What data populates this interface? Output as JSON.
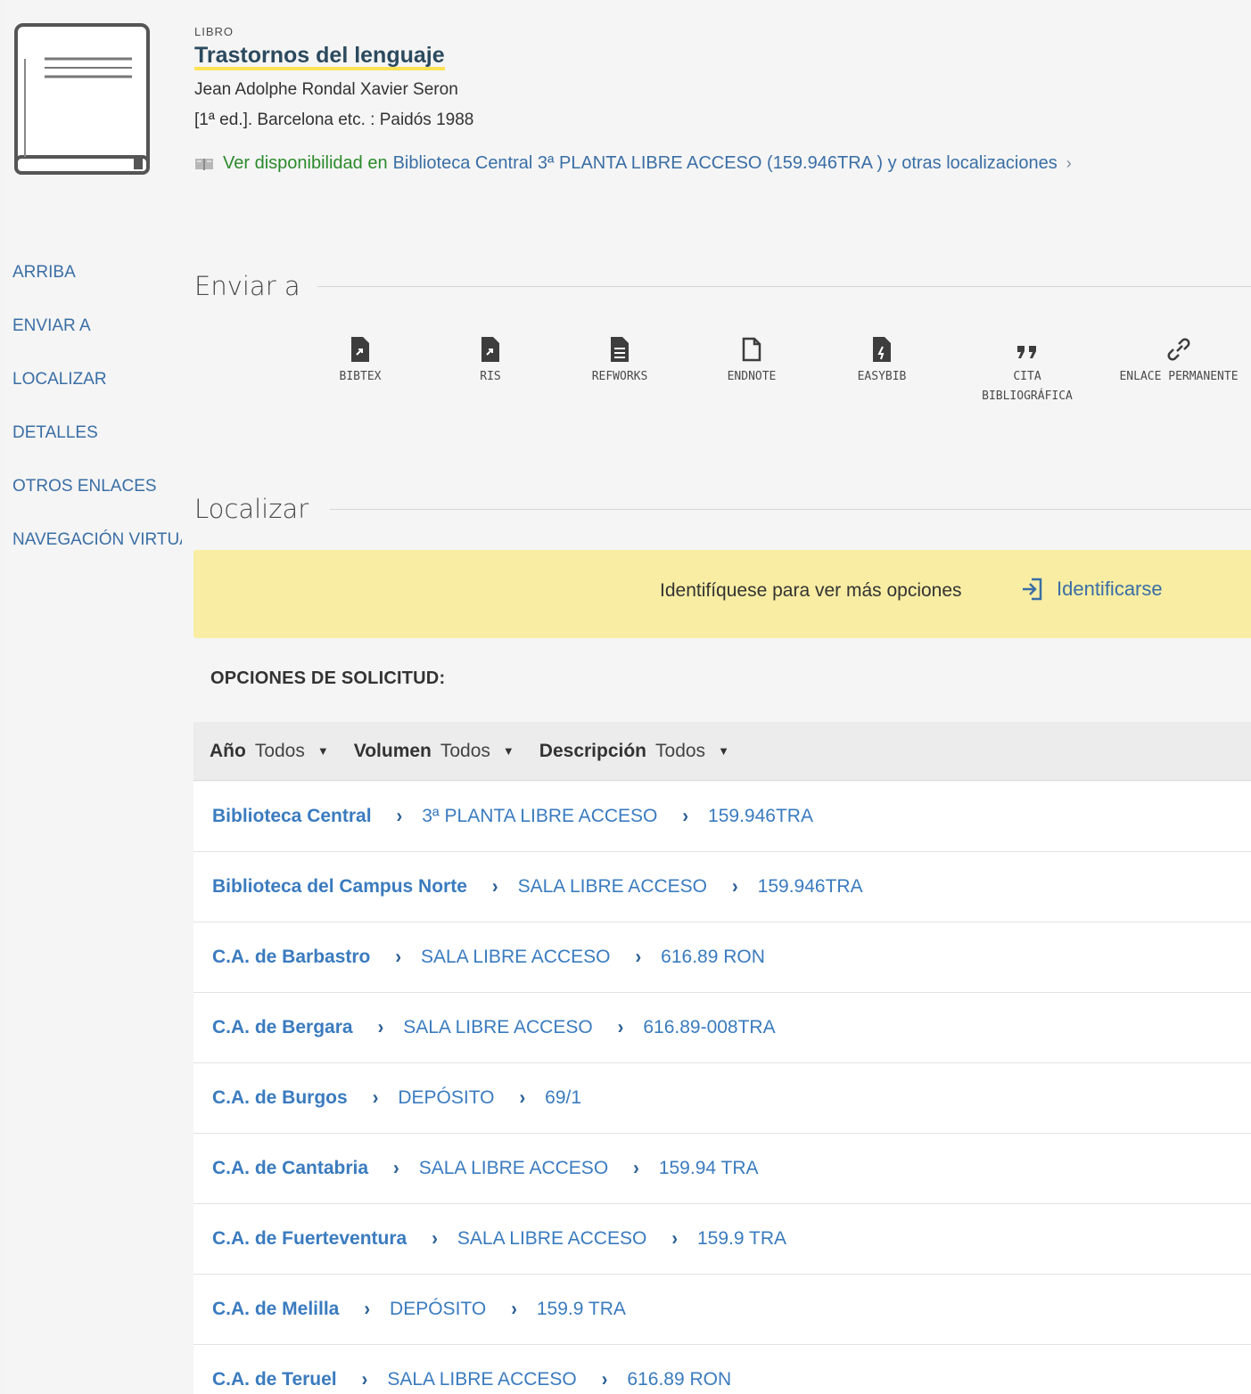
{
  "record": {
    "type": "LIBRO",
    "title": "Trastornos del lenguaje",
    "authors": "Jean Adolphe Rondal Xavier Seron",
    "edition": "[1ª ed.]. Barcelona etc. : Paidós 1988",
    "availability": {
      "status": "Ver disponibilidad en",
      "location": "Biblioteca Central  3ª PLANTA LIBRE ACCESO (159.946TRA ) y otras localizaciones",
      "chevron": "›"
    }
  },
  "side_nav": [
    "ARRIBA",
    "ENVIAR A",
    "LOCALIZAR",
    "DETALLES",
    "OTROS ENLACES",
    "NAVEGACIÓN VIRTUAL"
  ],
  "sections": {
    "send_to": "Enviar a",
    "locate": "Localizar"
  },
  "send_to_items": [
    {
      "label": "BIBTEX",
      "icon": "bibtex-icon"
    },
    {
      "label": "RIS",
      "icon": "ris-icon"
    },
    {
      "label": "REFWORKS",
      "icon": "refworks-icon"
    },
    {
      "label": "ENDNOTE",
      "icon": "endnote-icon"
    },
    {
      "label": "EASYBIB",
      "icon": "easybib-icon"
    },
    {
      "label": "CITA BIBLIOGRÁFICA",
      "icon": "quote-icon"
    },
    {
      "label": "ENLACE PERMANENTE",
      "icon": "link-icon"
    }
  ],
  "login": {
    "text": "Identifíquese para ver más opciones",
    "link": "Identificarse"
  },
  "request_heading": "OPCIONES DE SOLICITUD:",
  "filters": [
    {
      "label": "Año",
      "value": "Todos"
    },
    {
      "label": "Volumen",
      "value": "Todos"
    },
    {
      "label": "Descripción",
      "value": "Todos"
    }
  ],
  "locations": [
    {
      "library": "Biblioteca Central",
      "sublocation": "3ª PLANTA LIBRE ACCESO",
      "call_number": "159.946TRA"
    },
    {
      "library": "Biblioteca del Campus Norte",
      "sublocation": "SALA LIBRE ACCESO",
      "call_number": "159.946TRA"
    },
    {
      "library": "C.A. de Barbastro",
      "sublocation": "SALA LIBRE ACCESO",
      "call_number": "616.89 RON"
    },
    {
      "library": "C.A. de Bergara",
      "sublocation": "SALA LIBRE ACCESO",
      "call_number": "616.89-008TRA"
    },
    {
      "library": "C.A. de Burgos",
      "sublocation": "DEPÓSITO",
      "call_number": "69/1"
    },
    {
      "library": "C.A. de Cantabria",
      "sublocation": "SALA LIBRE ACCESO",
      "call_number": "159.94 TRA"
    },
    {
      "library": "C.A. de Fuerteventura",
      "sublocation": "SALA LIBRE ACCESO",
      "call_number": "159.9 TRA"
    },
    {
      "library": "C.A. de Melilla",
      "sublocation": "DEPÓSITO",
      "call_number": "159.9 TRA"
    },
    {
      "library": "C.A. de Teruel",
      "sublocation": "SALA LIBRE ACCESO",
      "call_number": "616.89 RON"
    }
  ],
  "colors": {
    "link": "#3a7bbf",
    "available": "#2b8a2b",
    "banner": "#f8eda3",
    "title_highlight": "#ffe256"
  }
}
